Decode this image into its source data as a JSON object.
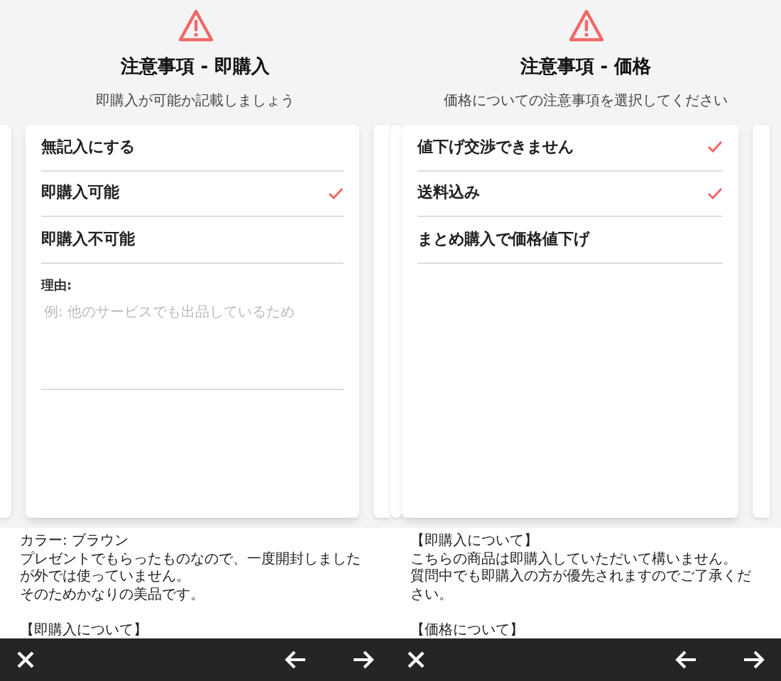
{
  "panels": [
    {
      "title": "注意事項 - 即購入",
      "subtitle": "即購入が可能か記載しましょう",
      "options": [
        {
          "label": "無記入にする",
          "checked": false
        },
        {
          "label": "即購入可能",
          "checked": true
        },
        {
          "label": "即購入不可能",
          "checked": false
        }
      ],
      "reason": {
        "label": "理由:",
        "placeholder": "例: 他のサービスでも出品しているため"
      },
      "description": [
        [
          "カラー: ブラウン",
          "プレゼントでもらったものなので、一度開封しましたが外では使っていません。",
          "そのためかなりの美品です。"
        ],
        [
          "【即購入について】"
        ]
      ]
    },
    {
      "title": "注意事項 - 価格",
      "subtitle": "価格についての注意事項を選択してください",
      "options": [
        {
          "label": "値下げ交渉できません",
          "checked": true
        },
        {
          "label": "送料込み",
          "checked": true
        },
        {
          "label": "まとめ購入で価格値下げ",
          "checked": false
        }
      ],
      "description": [
        [
          "【即購入について】",
          "こちらの商品は即購入していただいて構いません。",
          "質問中でも即購入の方が優先されますのでご了承ください。"
        ],
        [
          "【価格について】"
        ]
      ]
    }
  ]
}
